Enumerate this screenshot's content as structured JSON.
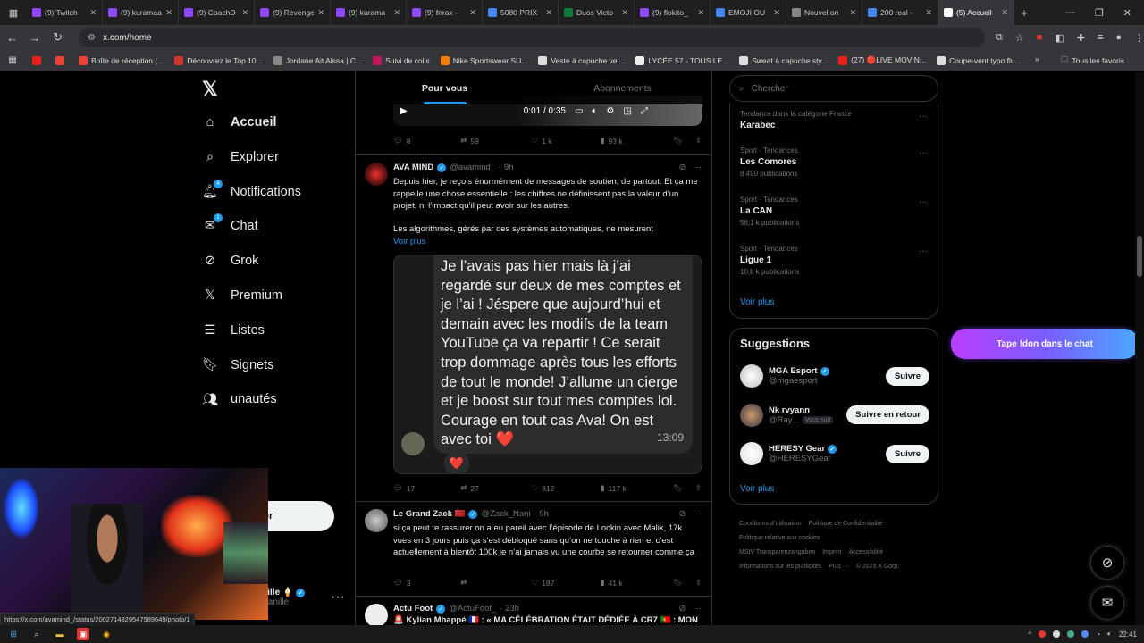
{
  "browser": {
    "tabs": [
      {
        "label": "(9) Twitch",
        "color": "#9146ff"
      },
      {
        "label": "(9) kuramaaa",
        "color": "#9146ff"
      },
      {
        "label": "(9) CoachD",
        "color": "#9146ff"
      },
      {
        "label": "(9) Revenge",
        "color": "#9146ff"
      },
      {
        "label": "(9) kurama",
        "color": "#9146ff"
      },
      {
        "label": "(9) fnrax -",
        "color": "#9146ff"
      },
      {
        "label": "5080 PRIX",
        "color": "#4285f4"
      },
      {
        "label": "Duos Victo",
        "color": "#0a7c3a"
      },
      {
        "label": "(9) flokito_",
        "color": "#9146ff"
      },
      {
        "label": "EMOJI OU",
        "color": "#4285f4"
      },
      {
        "label": "Nouvel on",
        "color": "#888888"
      },
      {
        "label": "200 real -",
        "color": "#4285f4"
      },
      {
        "label": "(5) Accueil",
        "color": "#ffffff"
      }
    ],
    "url": "x.com/home",
    "bookmarks": [
      {
        "label": "",
        "color": "#e62117"
      },
      {
        "label": "",
        "color": "#ea4335"
      },
      {
        "label": "Boîte de réception (...",
        "color": "#ea4335"
      },
      {
        "label": "Découvrez le Top 10...",
        "color": "#d0342c"
      },
      {
        "label": "Jordane Ait Aissa | C...",
        "color": "#888888"
      },
      {
        "label": "Suivi de colis",
        "color": "#c2185b"
      },
      {
        "label": "Nike Sportswear SU...",
        "color": "#f57c00"
      },
      {
        "label": "Veste à capuche vel...",
        "color": "#dddddd"
      },
      {
        "label": "LYCÉE 57 - TOUS LE...",
        "color": "#eeeeee"
      },
      {
        "label": "Sweat à capuche sty...",
        "color": "#dddddd"
      },
      {
        "label": "(27) 🔴LIVE MOVIN...",
        "color": "#e62117"
      },
      {
        "label": "Coupe-vent typo flu...",
        "color": "#dddddd"
      }
    ],
    "all_bookmarks": "Tous les favoris",
    "status_url": "https://x.com/avamind_/status/2002714829547589649/photo/1"
  },
  "nav": {
    "items": [
      {
        "label": "Accueil",
        "icon": "home-icon",
        "badge": ""
      },
      {
        "label": "Explorer",
        "icon": "search-icon",
        "badge": ""
      },
      {
        "label": "Notifications",
        "icon": "bell-icon",
        "badge": "4"
      },
      {
        "label": "Chat",
        "icon": "mail-icon",
        "badge": "1"
      },
      {
        "label": "Grok",
        "icon": "grok-icon",
        "badge": ""
      },
      {
        "label": "Premium",
        "icon": "x-icon",
        "badge": ""
      },
      {
        "label": "Listes",
        "icon": "list-icon",
        "badge": ""
      },
      {
        "label": "Signets",
        "icon": "bookmark-icon",
        "badge": ""
      },
      {
        "label": "unautés",
        "icon": "communities-icon",
        "badge": ""
      }
    ],
    "post_button": "ker",
    "account": {
      "name": "Jolavanille 🍦",
      "handle": "@JoLaVanille"
    }
  },
  "feed": {
    "tabs": [
      "Pour vous",
      "Abonnements"
    ],
    "video": {
      "time": "0:01 / 0:35"
    },
    "first_actions": {
      "replies": "8",
      "retweets": "59",
      "likes": "1 k",
      "views": "93 k"
    },
    "tweet1": {
      "name": "AVA MIND",
      "handle": "@avamind_",
      "time": "· 9h",
      "text": "Depuis hier, je reçois énormément de messages de soutien, de partout. Et ça me rappelle une chose essentielle : les chiffres ne définissent pas la valeur d’un projet, ni l’impact qu’il peut avoir sur les autres.",
      "text2": "Les algorithmes, gérés par des systèmes automatiques, ne mesurent",
      "voir_plus": "Voir plus",
      "bubble": "Je l’avais pas hier mais là j’ai regardé sur deux de mes comptes et je l’ai ! Jéspere que aujourd’hui et demain avec les modifs de la team YouTube ça va repartir ! Ce serait trop dommage après tous les efforts de tout le monde! J’allume un cierge et je boost sur tout mes comptes lol. Courage en tout cas Ava! On est avec toi ❤️",
      "bubble_time": "13:09",
      "reaction": "❤️",
      "actions": {
        "replies": "17",
        "retweets": "27",
        "likes": "812",
        "views": "117 k"
      }
    },
    "tweet2": {
      "name": "Le Grand Zack 🇲🇦",
      "handle": "@Zack_Nani",
      "time": "· 9h",
      "text": "si ça peut te rassurer on a eu pareil avec l’épisode de Lockin avec Malik, 17k vues en 3 jours puis ça s’est débloqué sans qu’on ne touche à rien et c’est actuellement à bientôt 100k je n’ai jamais vu une courbe se retourner comme ça",
      "actions": {
        "replies": "3",
        "retweets": "",
        "likes": "187",
        "views": "41 k"
      }
    },
    "tweet3": {
      "name": "Actu Foot",
      "handle": "@ActuFoot_",
      "time": "· 23h",
      "text": "🚨 Kylian Mbappé 🇫🇷 : « MA CÉLÉBRATION ÉTAIT DÉDIÉE À CR7 🇵🇹 : MON"
    }
  },
  "sidebar": {
    "search_placeholder": "Chercher",
    "trends": [
      {
        "cat": "Tendance dans la catégorie France",
        "name": "Karabec",
        "count": ""
      },
      {
        "cat": "Sport · Tendances",
        "name": "Les Comores",
        "count": "8 490 publications"
      },
      {
        "cat": "Sport · Tendances",
        "name": "La CAN",
        "count": "56,1 k publications"
      },
      {
        "cat": "Sport · Tendances",
        "name": "Ligue 1",
        "count": "10,8 k publications"
      }
    ],
    "voir_plus": "Voir plus",
    "suggestions_title": "Suggestions",
    "suggestions": [
      {
        "name": "MGA Esport",
        "handle": "@mgaesport",
        "verified": true,
        "button": "Suivre",
        "follows_you": ""
      },
      {
        "name": "Nk rvyann",
        "handle": "@Ray...",
        "verified": false,
        "button": "Suivre en retour",
        "follows_you": "Vous suit"
      },
      {
        "name": "HERESY Gear",
        "handle": "@HERESYGear",
        "verified": true,
        "button": "Suivre",
        "follows_you": ""
      }
    ],
    "voir_plus2": "Voir plus",
    "footer": [
      "Conditions d’utilisation",
      "Politique de Confidentialité",
      "Politique relative aux cookies",
      "MStV Transparenzangaben",
      "Imprint",
      "Accessibilité",
      "Informations sur les publicités",
      "Plus ···",
      "© 2025 X Corp."
    ]
  },
  "overlay": {
    "don_text": "Tape !don dans le chat"
  },
  "taskbar": {
    "time": "22:41"
  }
}
